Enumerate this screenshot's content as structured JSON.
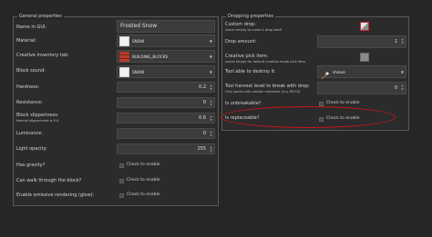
{
  "general": {
    "title": "General properties",
    "name_label": "Name in GUI:",
    "name_value": "Frosted Snow",
    "material_label": "Material:",
    "material_value": "SNOW",
    "tab_label": "Creative inventory tab:",
    "tab_value": "BUILDING_BLOCKS",
    "sound_label": "Block sound:",
    "sound_value": "SNOW",
    "hardness_label": "Hardness:",
    "hardness_value": "0.2",
    "resistance_label": "Resistance:",
    "resistance_value": "0",
    "slipperiness_label": "Block slipperiness:",
    "slipperiness_sub": "Normal slipperiness is 0.6",
    "slipperiness_value": "0.6",
    "luminance_label": "Luminance:",
    "luminance_value": "0",
    "opacity_label": "Light opacity:",
    "opacity_value": "255",
    "gravity_label": "Has gravity?",
    "walk_label": "Can walk through the block?",
    "emissive_label": "Enable emissive rendering (glow):",
    "check_text": "Check to enable"
  },
  "dropping": {
    "title": "Dropping properties",
    "custom_drop_label": "Custom drop:",
    "custom_drop_sub": "Leave empty to make it drop itself",
    "drop_amount_label": "Drop amount:",
    "drop_amount_value": "1",
    "pick_item_label": "Creative pick item:",
    "pick_item_sub": "Leave empty for default creative mode pick item",
    "tool_label": "Tool able to destroy it:",
    "tool_value": "shovel",
    "harvest_label": "Tool harvest level to break with drop:",
    "harvest_sub": "Only works with certain materials (e.g. ROCK)",
    "harvest_value": "0",
    "unbreakable_label": "Is unbreakable?",
    "replaceable_label": "Is replaceable?",
    "check_text": "Check to enable"
  },
  "colors": {
    "highlight": "#c8161a",
    "snow": "#f2f2f2",
    "brick": "#b8392b"
  }
}
